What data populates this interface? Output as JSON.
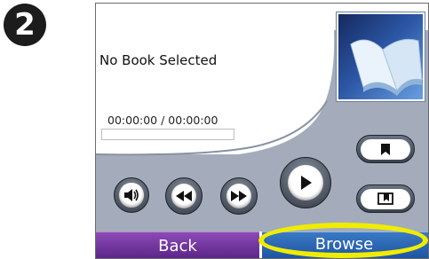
{
  "step": {
    "number": "2"
  },
  "player": {
    "title": "No Book Selected",
    "time": "00:00:00 / 00:00:00",
    "progress_fraction": 0
  },
  "bottom_bar": {
    "back_label": "Back",
    "browse_label": "Browse"
  },
  "icons": {
    "volume": "volume-icon",
    "rewind": "rewind-icon",
    "fast_forward": "fast-forward-icon",
    "play": "play-icon",
    "bookmark": "bookmark-icon",
    "bookmark_list": "bookmark-list-icon",
    "cover": "open-book-icon"
  },
  "colors": {
    "back_button": "#6f2f9e",
    "browse_button": "#2a63b2",
    "highlight": "#f0ec00",
    "panel": "#a4acbb"
  }
}
